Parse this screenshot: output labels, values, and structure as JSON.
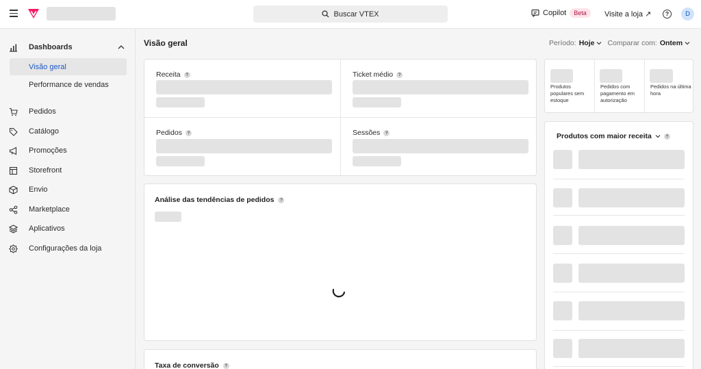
{
  "topbar": {
    "search_label": "Buscar VTEX",
    "copilot_label": "Copilot",
    "beta_badge": "Beta",
    "visit_store_label": "Visite a loja ↗",
    "help_label": "?",
    "avatar_initial": "D",
    "brand_color": "#f71963"
  },
  "sidebar": {
    "dashboards_label": "Dashboards",
    "sub_items": [
      "Visão geral",
      "Performance de vendas"
    ],
    "items": [
      "Pedidos",
      "Catálogo",
      "Promoções",
      "Storefront",
      "Envio",
      "Marketplace",
      "Aplicativos",
      "Configurações da loja"
    ]
  },
  "main": {
    "title": "Visão geral",
    "period_label": "Período:",
    "period_value": "Hoje",
    "compare_label": "Comparar com:",
    "compare_value": "Ontem",
    "metrics": [
      "Receita",
      "Ticket médio",
      "Pedidos",
      "Sessões"
    ],
    "trend_title": "Análise das tendências de pedidos",
    "conversion_title": "Taxa de conversão"
  },
  "right": {
    "mini_cards": [
      "Produtos populares sem estoque",
      "Pedidos com pagamento em autorização",
      "Pedidos na última hora"
    ],
    "top_products_title": "Produtos com maior receita"
  }
}
